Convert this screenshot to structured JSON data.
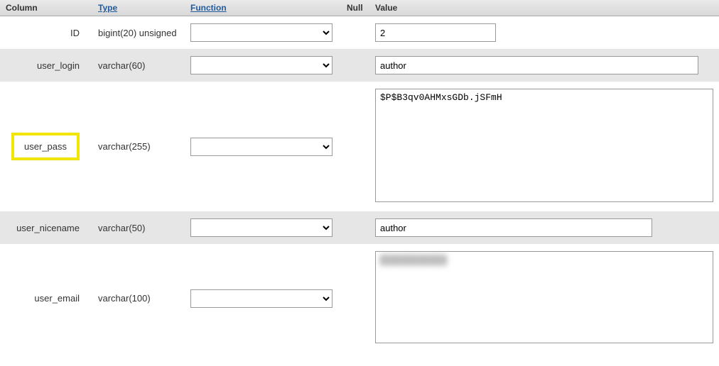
{
  "header": {
    "column": "Column",
    "type": "Type",
    "function": "Function",
    "null": "Null",
    "value": "Value"
  },
  "rows": [
    {
      "col": "ID",
      "type": "bigint(20) unsigned",
      "value": "2",
      "value_kind": "input",
      "value_width": 170,
      "highlight": false,
      "null_checkbox": false,
      "bg": "odd"
    },
    {
      "col": "user_login",
      "type": "varchar(60)",
      "value": "author",
      "value_kind": "input",
      "value_width": 455,
      "highlight": false,
      "null_checkbox": false,
      "bg": "even"
    },
    {
      "col": "user_pass",
      "type": "varchar(255)",
      "value": "$P$B3qv0AHMxsGDb.jSFmH",
      "value_kind": "textarea",
      "textarea_rows": 10,
      "highlight": true,
      "null_checkbox": false,
      "bg": "odd"
    },
    {
      "col": "user_nicename",
      "type": "varchar(50)",
      "value": "author",
      "value_kind": "input",
      "value_width": 390,
      "highlight": false,
      "null_checkbox": false,
      "bg": "even"
    },
    {
      "col": "user_email",
      "type": "varchar(100)",
      "value": "",
      "value_kind": "textarea",
      "textarea_rows": 8,
      "highlight": false,
      "null_checkbox": false,
      "bg": "odd",
      "value_blurred": true
    }
  ]
}
